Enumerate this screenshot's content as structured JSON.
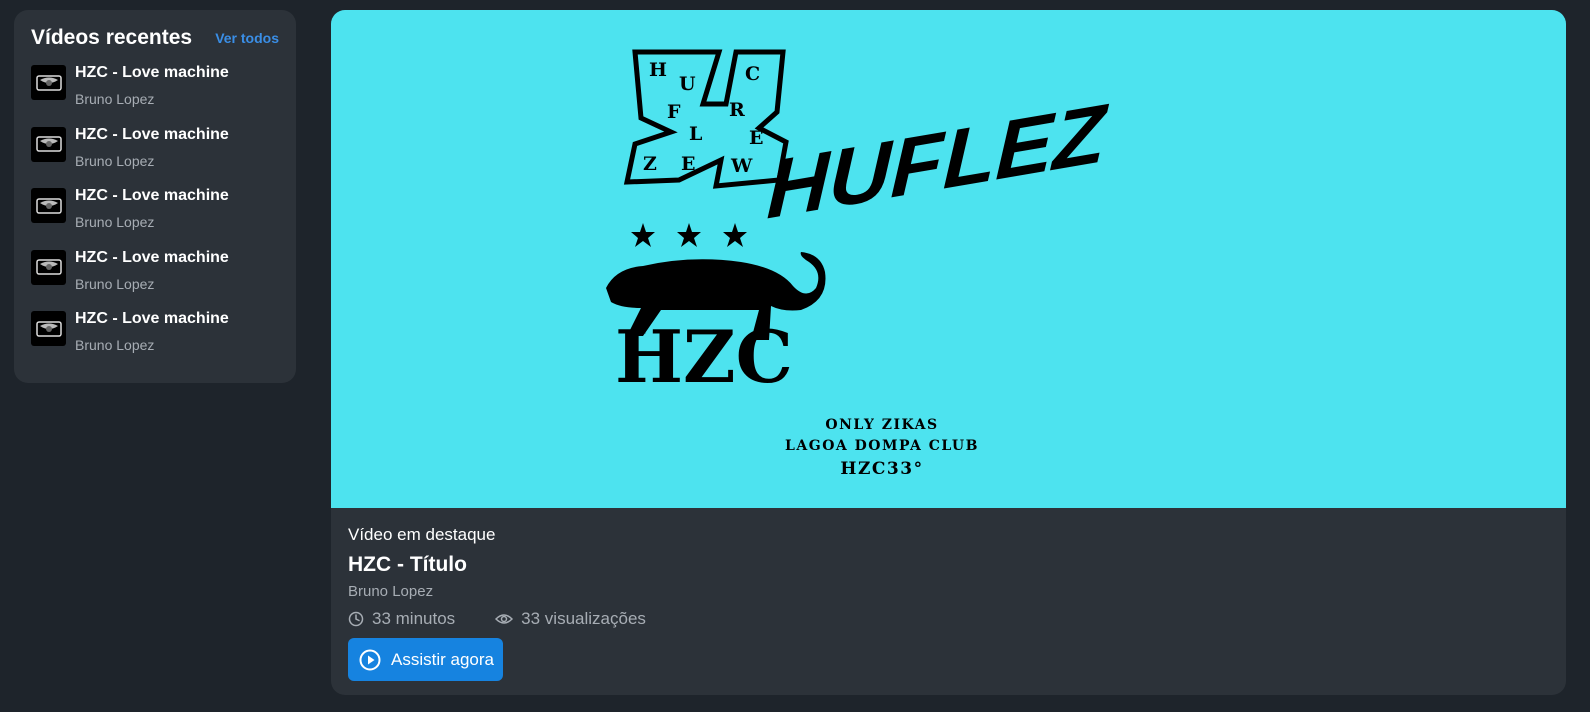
{
  "sidebar": {
    "title": "Vídeos recentes",
    "see_all": "Ver todos",
    "videos": [
      {
        "title": "HZC - Love machine",
        "author": "Bruno Lopez",
        "icon": "video-thumbnail"
      },
      {
        "title": "HZC - Love machine",
        "author": "Bruno Lopez",
        "icon": "video-thumbnail"
      },
      {
        "title": "HZC - Love machine",
        "author": "Bruno Lopez",
        "icon": "video-thumbnail"
      },
      {
        "title": "HZC - Love machine",
        "author": "Bruno Lopez",
        "icon": "video-thumbnail"
      },
      {
        "title": "HZC - Love machine",
        "author": "Bruno Lopez",
        "icon": "video-thumbnail"
      }
    ]
  },
  "featured": {
    "banner": {
      "background": "#4de3ef",
      "logo_33_letters": [
        "H",
        "U",
        "C",
        "F",
        "R",
        "L",
        "E",
        "Z",
        "E",
        "W"
      ],
      "brand": "HUFLEZ",
      "emblem": "HZC",
      "tagline": [
        "ONLY ZIKAS",
        "LAGOA DOMPA CLUB",
        "HZC33°"
      ]
    },
    "label": "Vídeo em destaque",
    "title": "HZC - Título",
    "author": "Bruno Lopez",
    "duration": "33 minutos",
    "views": "33 visualizações",
    "duration_icon": "clock-icon",
    "views_icon": "eye-icon",
    "cta": "Assistir agora",
    "cta_icon": "play-circle-icon"
  },
  "colors": {
    "page_bg": "#1e242b",
    "card_bg": "#2c3239",
    "accent": "#1683e0",
    "link": "#3a8ee6",
    "muted_text": "#a7adb4"
  }
}
